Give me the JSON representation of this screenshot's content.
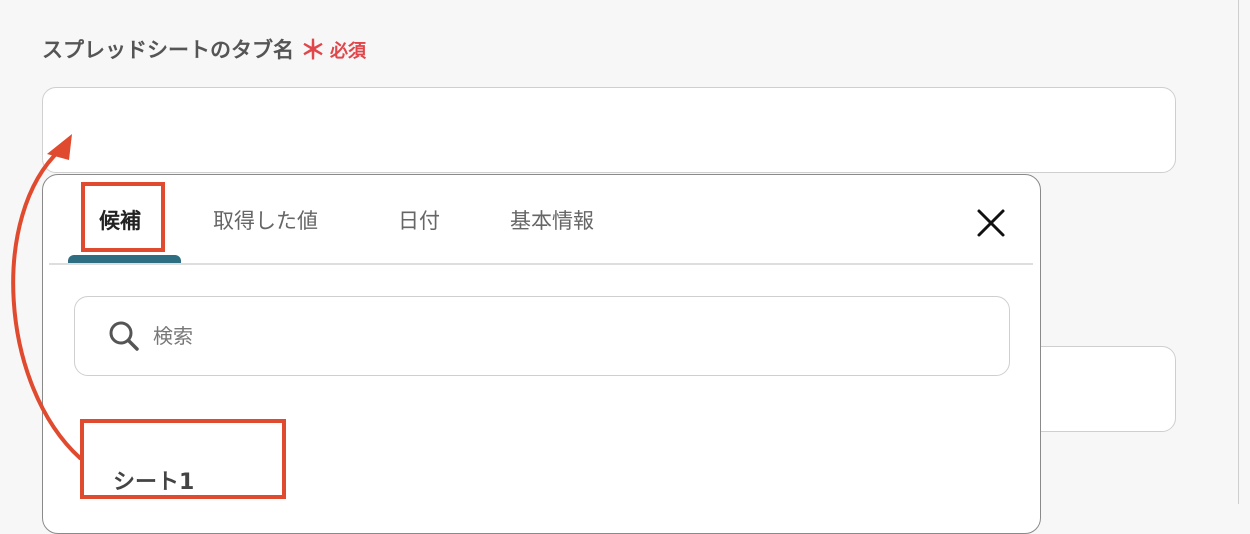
{
  "form": {
    "field_label": "スプレッドシートのタブ名",
    "required_mark": "＊",
    "required_text": "必須",
    "input_value": ""
  },
  "popup": {
    "tabs": [
      {
        "label": "候補",
        "active": true
      },
      {
        "label": "取得した値",
        "active": false
      },
      {
        "label": "日付",
        "active": false
      },
      {
        "label": "基本情報",
        "active": false
      }
    ],
    "close_icon": "close-icon",
    "search": {
      "icon": "search-icon",
      "placeholder": "検索",
      "value": ""
    },
    "items": [
      {
        "label": "シート1"
      }
    ]
  },
  "colors": {
    "required": "#e0464a",
    "tab_indicator": "#2e6e82",
    "annotation": "#e04a2e"
  }
}
